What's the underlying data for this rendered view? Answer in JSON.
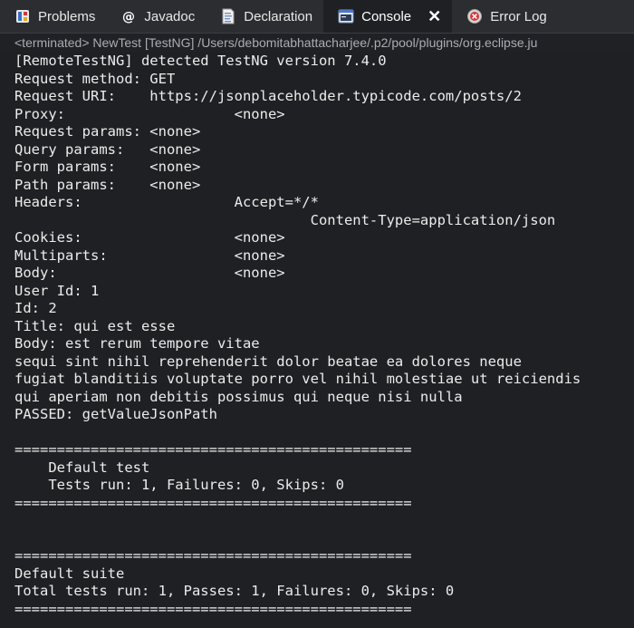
{
  "tabs": [
    {
      "label": "Problems",
      "icon": "problems-icon",
      "active": false
    },
    {
      "label": "Javadoc",
      "icon": "javadoc-icon",
      "active": false
    },
    {
      "label": "Declaration",
      "icon": "declaration-icon",
      "active": false
    },
    {
      "label": "Console",
      "icon": "console-icon",
      "active": true,
      "close": "✕"
    },
    {
      "label": "Error Log",
      "icon": "error-log-icon",
      "active": false
    }
  ],
  "status": "<terminated> NewTest [TestNG] /Users/debomitabhattacharjee/.p2/pool/plugins/org.eclipse.ju",
  "console": {
    "lines": [
      "[RemoteTestNG] detected TestNG version 7.4.0",
      "Request method: GET",
      "Request URI:    https://jsonplaceholder.typicode.com/posts/2",
      "Proxy:                    <none>",
      "Request params: <none>",
      "Query params:   <none>",
      "Form params:    <none>",
      "Path params:    <none>",
      "Headers:                  Accept=*/*",
      "                                   Content-Type=application/json",
      "Cookies:                  <none>",
      "Multiparts:               <none>",
      "Body:                     <none>",
      "User Id: 1",
      "Id: 2",
      "Title: qui est esse",
      "Body: est rerum tempore vitae",
      "sequi sint nihil reprehenderit dolor beatae ea dolores neque",
      "fugiat blanditiis voluptate porro vel nihil molestiae ut reiciendis",
      "qui aperiam non debitis possimus qui neque nisi nulla",
      "PASSED: getValueJsonPath",
      "",
      "===============================================",
      "    Default test",
      "    Tests run: 1, Failures: 0, Skips: 0",
      "===============================================",
      "",
      "",
      "===============================================",
      "Default suite",
      "Total tests run: 1, Passes: 1, Failures: 0, Skips: 0",
      "==============================================="
    ]
  }
}
